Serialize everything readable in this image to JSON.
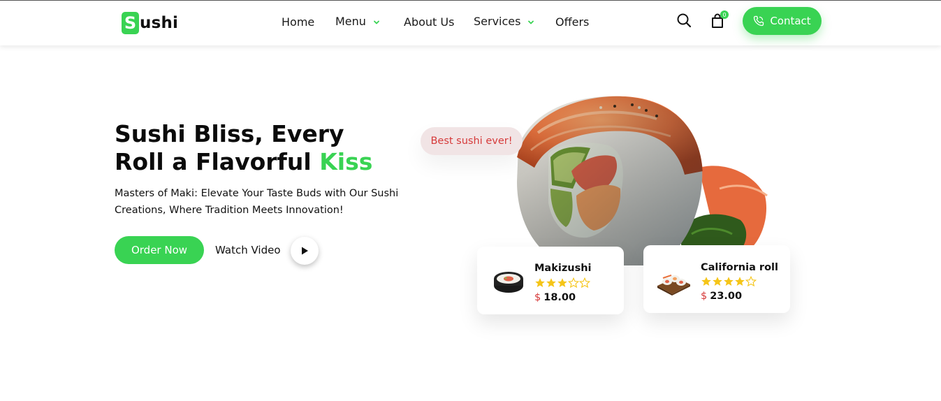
{
  "brand": {
    "logo_letter": "S",
    "logo_rest": "ushi",
    "accent_color": "#39d353",
    "price_color": "#d63a3a"
  },
  "nav": {
    "items": [
      {
        "label": "Home",
        "has_dropdown": false
      },
      {
        "label": "Menu",
        "has_dropdown": true
      },
      {
        "label": "About Us",
        "has_dropdown": false
      },
      {
        "label": "Services",
        "has_dropdown": true
      },
      {
        "label": "Offers",
        "has_dropdown": false
      }
    ],
    "cart_count": "0",
    "contact_label": "Contact",
    "icons": [
      "search-icon",
      "cart-bag-icon",
      "phone-icon",
      "chevron-down-icon"
    ]
  },
  "hero": {
    "title_line1": "Sushi Bliss, Every",
    "title_line2_prefix": "Roll a Flavorful ",
    "title_line2_accent": "Kiss",
    "subtitle": "Masters of Maki: Elevate Your Taste Buds with Our Sushi Creations, Where Tradition Meets Innovation!",
    "order_label": "Order Now",
    "watch_label": "Watch Video",
    "bubble_text": "Best sushi ever!"
  },
  "products": [
    {
      "name": "Makizushi",
      "rating": 3,
      "max_rating": 5,
      "currency": "$",
      "price": "18.00"
    },
    {
      "name": "California roll",
      "rating": 4,
      "max_rating": 5,
      "currency": "$",
      "price": "23.00"
    }
  ]
}
